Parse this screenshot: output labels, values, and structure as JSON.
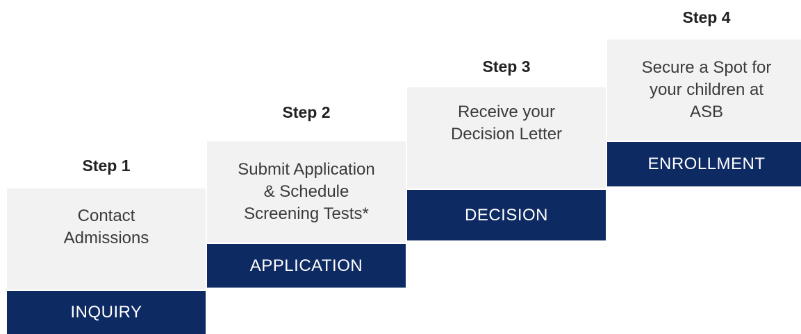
{
  "steps": [
    {
      "label": "Step 1",
      "description": "Contact\nAdmissions",
      "stage": "INQUIRY"
    },
    {
      "label": "Step 2",
      "description": "Submit Application\n& Schedule\nScreening Tests*",
      "stage": "APPLICATION"
    },
    {
      "label": "Step 3",
      "description": "Receive your\nDecision Letter",
      "stage": "DECISION"
    },
    {
      "label": "Step 4",
      "description": "Secure a Spot for\nyour children at\nASB",
      "stage": "ENROLLMENT"
    }
  ],
  "colors": {
    "box_background": "#f2f2f2",
    "bar_background": "#0e2a63",
    "bar_text": "#ffffff",
    "label_text": "#222222"
  }
}
